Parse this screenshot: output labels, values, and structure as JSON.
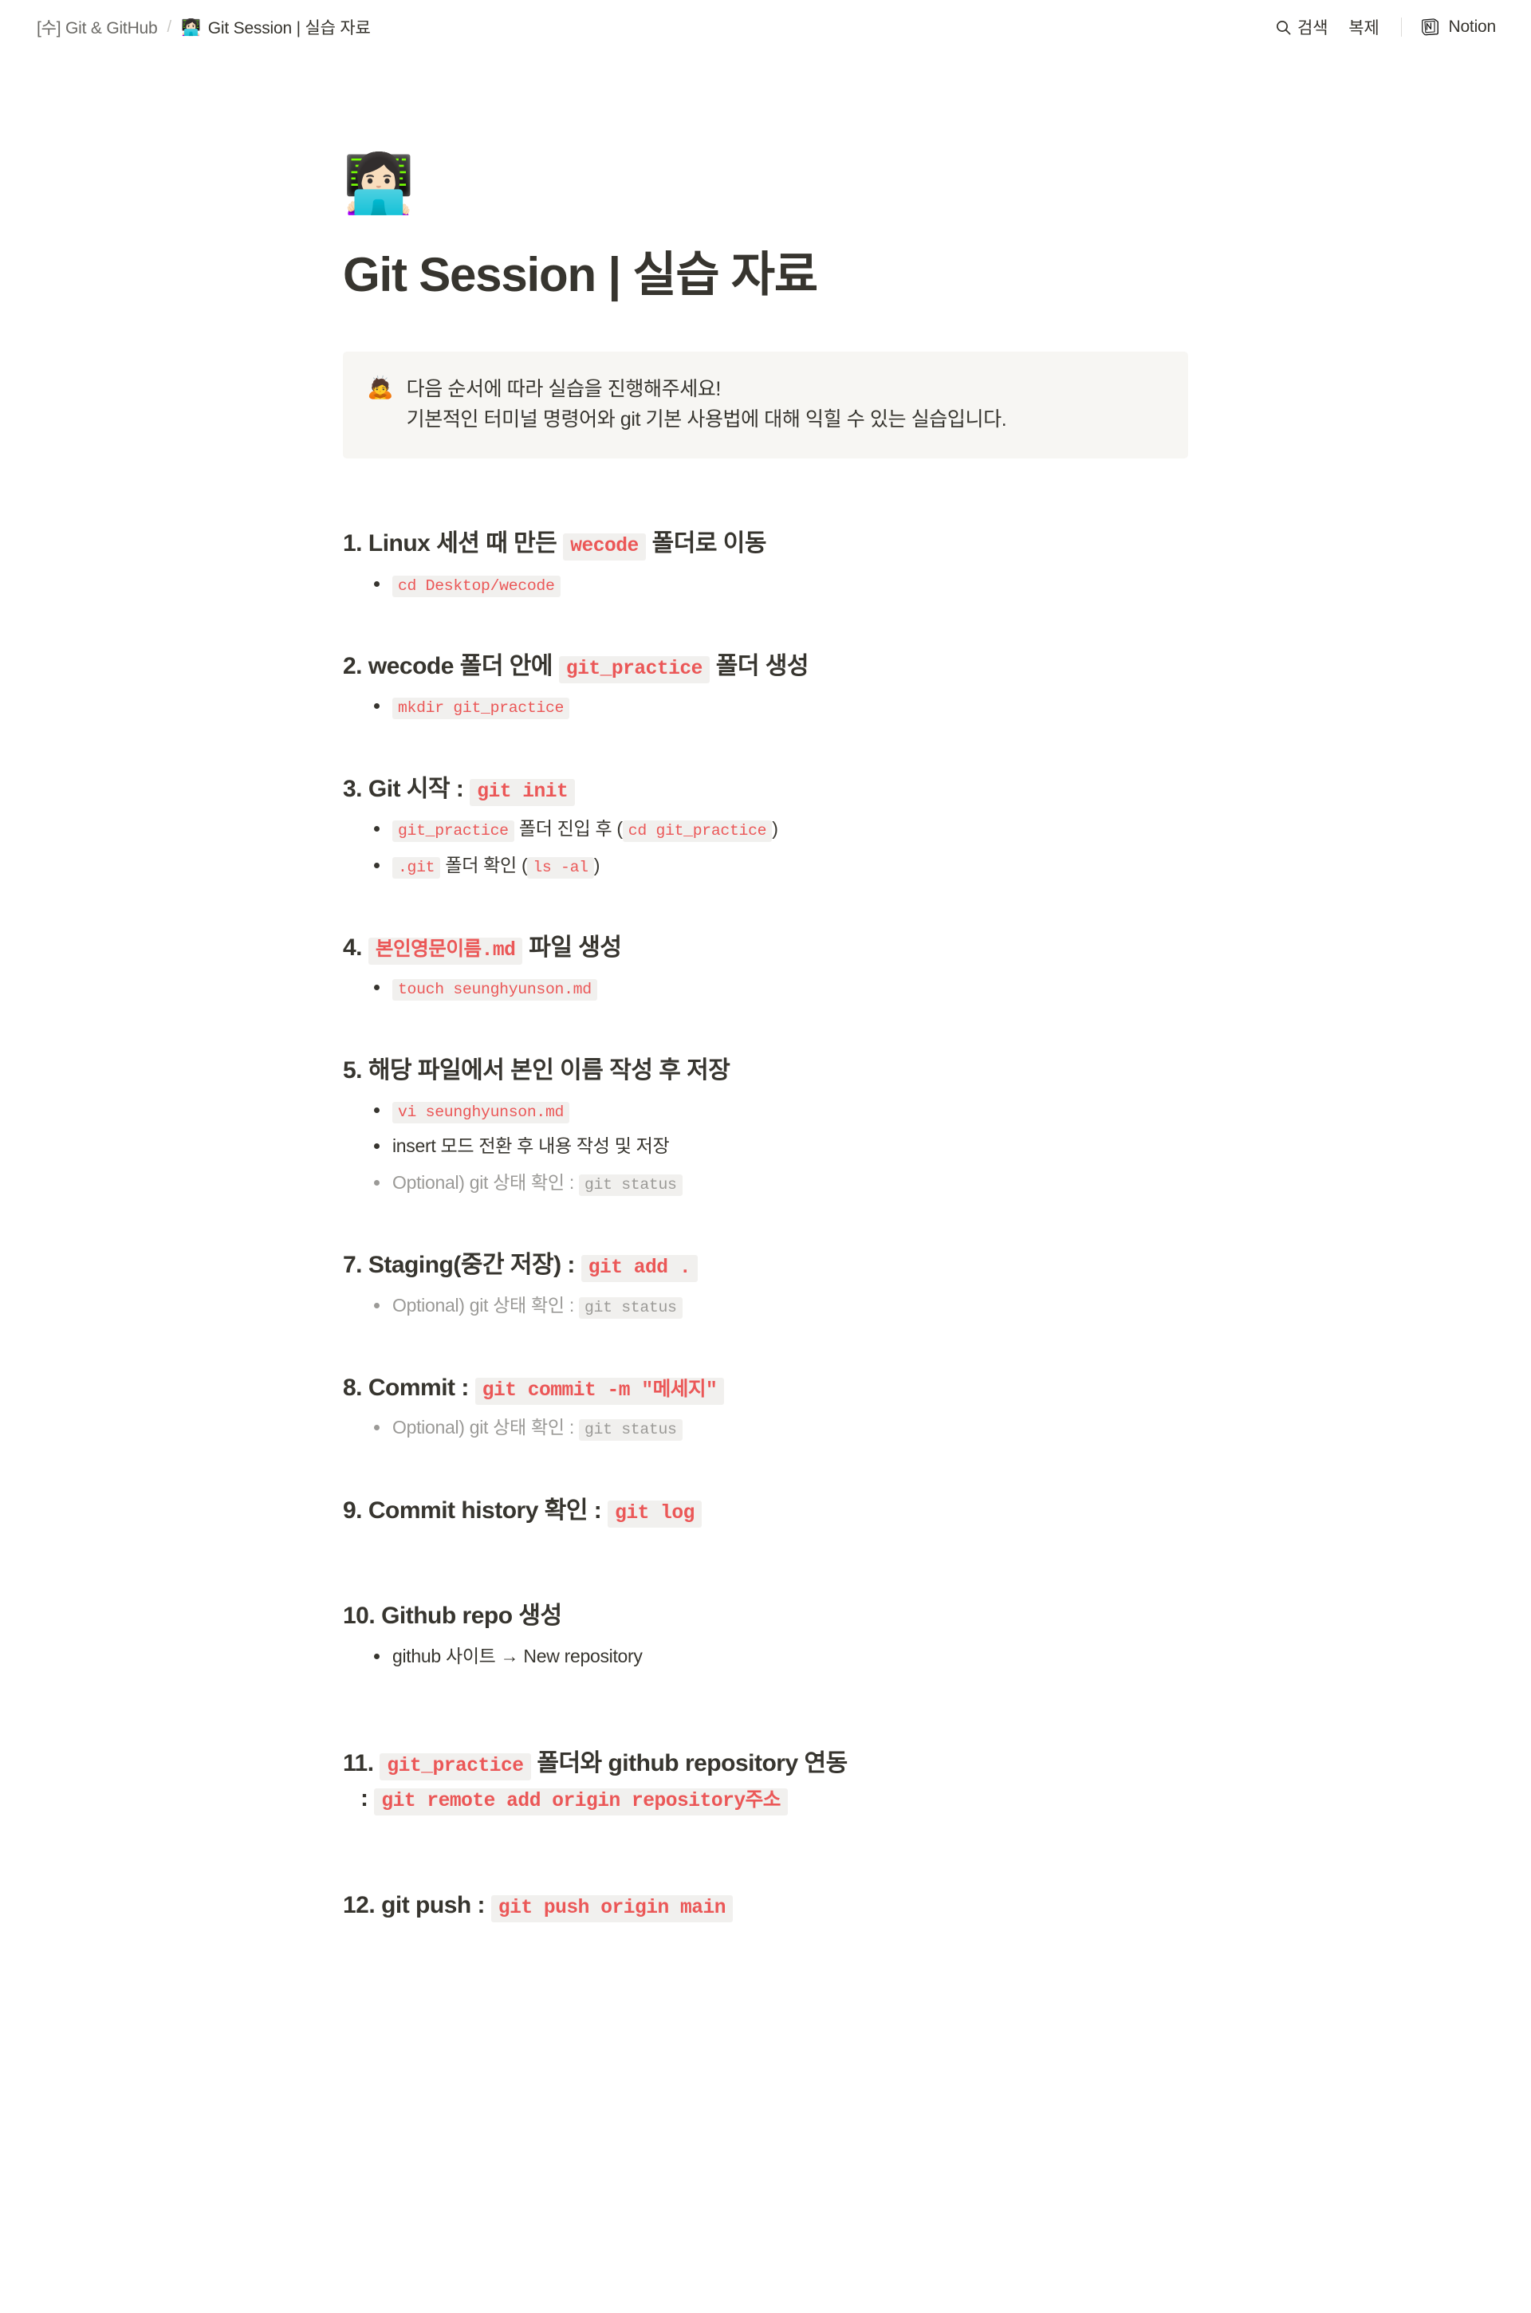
{
  "topbar": {
    "breadcrumb": {
      "parent": "[수] Git & GitHub",
      "separator": "/",
      "current_emoji": "👩🏻‍💻",
      "current": "Git Session | 실습 자료"
    },
    "actions": {
      "search_icon": "search-icon",
      "search_label": "검색",
      "duplicate_label": "복제",
      "notion_icon": "notion-logo",
      "notion_label": "Notion"
    }
  },
  "page": {
    "emoji": "👩🏻‍💻",
    "title": "Git Session | 실습 자료"
  },
  "callout": {
    "emoji": "🙇",
    "line1": "다음 순서에 따라 실습을 진행해주세요!",
    "line2": "기본적인 터미널 명령어와 git 기본 사용법에 대해 익힐 수 있는 실습입니다."
  },
  "steps": [
    {
      "number": "1.",
      "heading_pre": "Linux 세션 때 만든 ",
      "heading_code": "wecode",
      "heading_post": " 폴더로 이동",
      "bullets": [
        {
          "code": "cd Desktop/wecode"
        }
      ]
    },
    {
      "number": "2.",
      "heading_pre": "wecode 폴더 안에 ",
      "heading_code": "git_practice",
      "heading_post": " 폴더 생성",
      "bullets": [
        {
          "code": "mkdir git_practice"
        }
      ]
    },
    {
      "number": "3.",
      "heading_pre": "Git 시작 : ",
      "heading_code": "git init",
      "heading_post": "",
      "bullets": [
        {
          "code_lead": "git_practice",
          "text": " 폴더 진입 후 ",
          "paren_open": "(",
          "code_tail": "cd git_practice",
          "paren_close": ")"
        },
        {
          "code_lead": ".git",
          "text": " 폴더 확인 ",
          "paren_open": "(",
          "code_tail": "ls -al",
          "paren_close": ")"
        }
      ]
    },
    {
      "number": "4.",
      "heading_pre": "",
      "heading_code": "본인영문이름.md",
      "heading_post": " 파일 생성",
      "bullets": [
        {
          "code": "touch seunghyunson.md"
        }
      ]
    },
    {
      "number": "5.",
      "heading_pre": "해당 파일에서 본인 이름 작성 후 저장",
      "heading_code": "",
      "heading_post": "",
      "bullets": [
        {
          "code": "vi seunghyunson.md"
        },
        {
          "plain": "insert 모드 전환 후 내용 작성 및 저장"
        },
        {
          "muted": true,
          "text": "Optional) git 상태 확인 : ",
          "code_tail": "git status"
        }
      ]
    },
    {
      "number": "7.",
      "heading_pre": "Staging(중간 저장) : ",
      "heading_code": "git add .",
      "heading_post": "",
      "bullets": [
        {
          "muted": true,
          "text": "Optional) git 상태 확인 : ",
          "code_tail": "git status"
        }
      ]
    },
    {
      "number": "8.",
      "heading_pre": "Commit : ",
      "heading_code": "git commit -m \"메세지\"",
      "heading_post": "",
      "bullets": [
        {
          "muted": true,
          "text": "Optional) git 상태 확인 : ",
          "code_tail": "git status"
        }
      ]
    },
    {
      "number": "9.",
      "heading_pre": "Commit history 확인 : ",
      "heading_code": "git log",
      "heading_post": "",
      "bullets": []
    },
    {
      "number": "10.",
      "heading_pre": "Github repo 생성",
      "heading_code": "",
      "heading_post": "",
      "bullets": [
        {
          "plain": "github 사이트 → New repository"
        }
      ]
    },
    {
      "number": "11.",
      "heading_pre": "",
      "heading_code": "git_practice",
      "heading_post": " 폴더와 github repository 연동",
      "heading_line2_pre": ": ",
      "heading_line2_code": "git remote add origin repository주소",
      "bullets": []
    },
    {
      "number": "12.",
      "heading_pre": "git push : ",
      "heading_code": "git push origin main",
      "heading_post": "",
      "bullets": []
    }
  ]
}
